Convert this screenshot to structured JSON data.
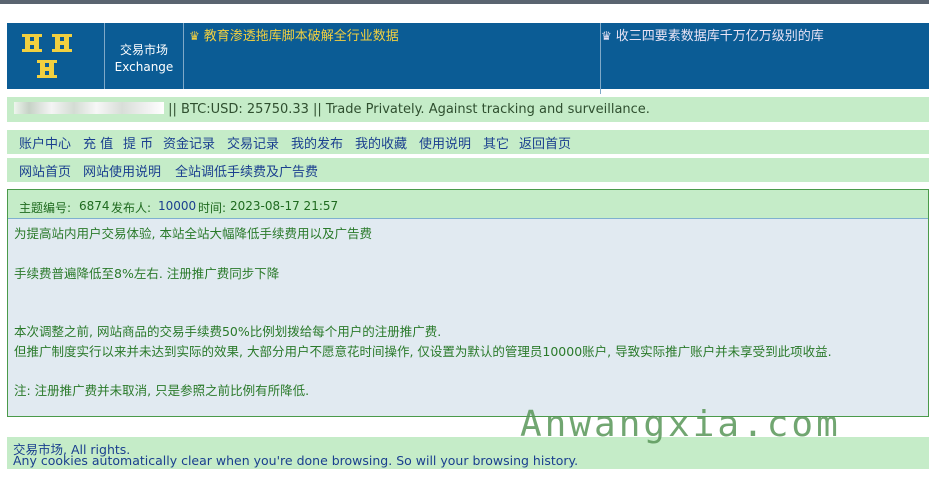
{
  "header": {
    "site_name_cn": "交易市场",
    "site_name_en": "Exchange",
    "ad_left": "教育渗透拖库脚本破解全行业数据",
    "ad_right": "收三四要素数据库千万亿万级别的库",
    "ad_left_color": "#f1d040"
  },
  "info_bar": {
    "rate_text": "|| BTC:USD: 25750.33 || Trade Privately. Against tracking and surveillance."
  },
  "nav_main": [
    "账户中心",
    "充 值",
    "提 币",
    "资金记录",
    "交易记录",
    "我的发布",
    "我的收藏",
    "使用说明",
    "其它",
    "返回首页"
  ],
  "nav_secondary": [
    "网站首页",
    "网站使用说明",
    "全站调低手续费及广告费"
  ],
  "topic": {
    "id_label": "主题编号:",
    "id": "6874",
    "poster_label": "发布人:",
    "poster": "10000",
    "time_label": "时间:",
    "time": "2023-08-17 21:57",
    "lines": [
      "为提高站内用户交易体验, 本站全站大幅降低手续费用以及广告费",
      "手续费普遍降低至8%左右. 注册推广费同步下降",
      "本次调整之前, 网站商品的交易手续费50%比例划拨给每个用户的注册推广费.",
      "但推广制度实行以来并未达到实际的效果, 大部分用户不愿意花时间操作, 仅设置为默认的管理员10000账户, 导致实际推广账户并未享受到此项收益.",
      "注: 注册推广费并未取消, 只是参照之前比例有所降低."
    ]
  },
  "footer": {
    "rights": "交易市场, All rights.",
    "cookies": "Any cookies automatically clear when you're done browsing. So will your browsing history."
  },
  "watermark": "Anwangxia.com",
  "colors": {
    "header_bg": "#0b5c95",
    "bar_green": "#c5ecc8",
    "link_blue": "#1a3f8f",
    "text_green": "#2a7a2a"
  }
}
